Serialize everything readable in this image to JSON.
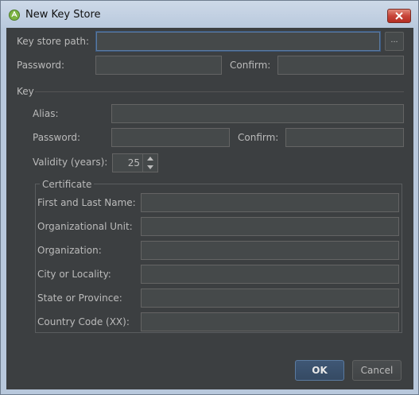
{
  "window": {
    "title": "New Key Store",
    "icon": "android-studio-icon",
    "close_icon": "close-icon"
  },
  "keystore": {
    "path_label": "Key store path:",
    "path_value": "",
    "browse_label": "...",
    "password_label": "Password:",
    "password_value": "",
    "confirm_label": "Confirm:",
    "confirm_value": ""
  },
  "key": {
    "section_title": "Key",
    "alias_label": "Alias:",
    "alias_value": "",
    "password_label": "Password:",
    "password_value": "",
    "confirm_label": "Confirm:",
    "confirm_value": "",
    "validity_label": "Validity (years):",
    "validity_value": "25"
  },
  "certificate": {
    "section_title": "Certificate",
    "fields": [
      {
        "label": "First and Last Name:",
        "value": ""
      },
      {
        "label": "Organizational Unit:",
        "value": ""
      },
      {
        "label": "Organization:",
        "value": ""
      },
      {
        "label": "City or Locality:",
        "value": ""
      },
      {
        "label": "State or Province:",
        "value": ""
      },
      {
        "label": "Country Code (XX):",
        "value": ""
      }
    ]
  },
  "buttons": {
    "ok_label": "OK",
    "cancel_label": "Cancel"
  },
  "colors": {
    "dialog_background": "#3c3f41",
    "field_background": "#45494a",
    "text": "#bbbbbb",
    "accent": "#5a7aa0"
  }
}
